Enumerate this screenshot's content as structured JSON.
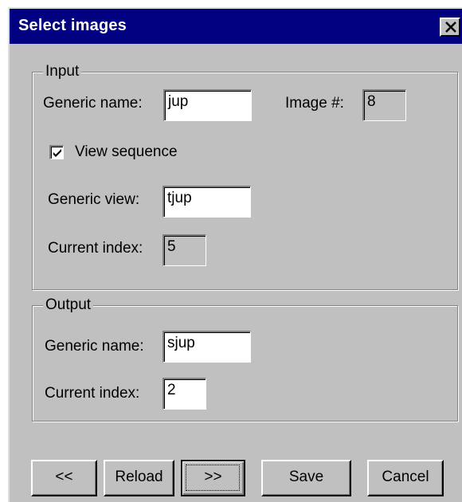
{
  "window": {
    "title": "Select images",
    "close_label": "✕"
  },
  "input_group": {
    "label": "Input",
    "generic_name_label": "Generic name:",
    "generic_name_value": "jup",
    "image_num_label": "Image #:",
    "image_num_value": "8",
    "view_sequence_label": "View sequence",
    "view_sequence_checked": true,
    "generic_view_label": "Generic view:",
    "generic_view_value": "tjup",
    "current_index_label": "Current index:",
    "current_index_value": "5"
  },
  "output_group": {
    "label": "Output",
    "generic_name_label": "Generic name:",
    "generic_name_value": "sjup",
    "current_index_label": "Current index:",
    "current_index_value": "2"
  },
  "buttons": {
    "prev": "<<",
    "reload": "Reload",
    "next": ">>",
    "save": "Save",
    "cancel": "Cancel"
  },
  "colors": {
    "titlebar": "#000080",
    "face": "#c0c0c0",
    "field": "#ffffff"
  }
}
